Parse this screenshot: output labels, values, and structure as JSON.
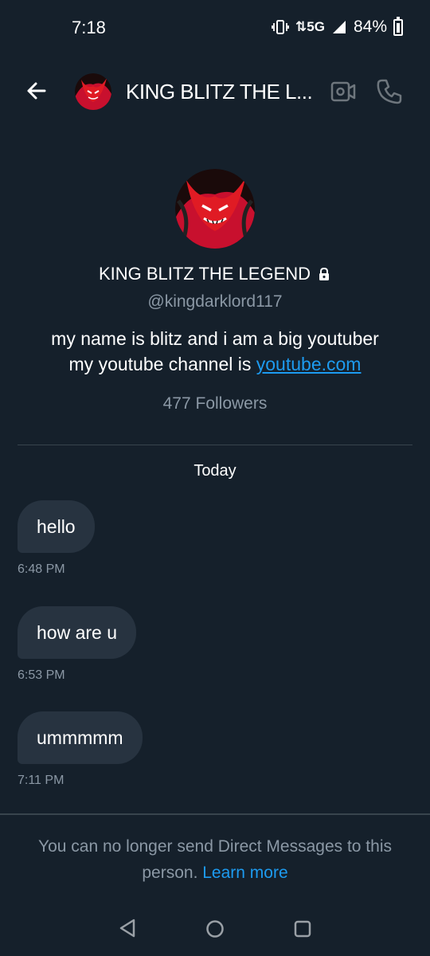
{
  "status_bar": {
    "time": "7:18",
    "network": "5G",
    "battery": "84%"
  },
  "header": {
    "title": "KING BLITZ THE L...",
    "back_icon": "back-arrow-icon",
    "video_icon": "video-call-icon",
    "call_icon": "phone-icon"
  },
  "profile": {
    "name": "KING BLITZ THE LEGEND",
    "handle": "@kingdarklord117",
    "bio_line1": "my name is blitz and i am a big youtuber",
    "bio_line2_prefix": "my youtube channel is ",
    "bio_link": "youtube.com",
    "followers": "477 Followers"
  },
  "conversation": {
    "date_label": "Today",
    "messages": [
      {
        "text": "hello",
        "time": "6:48 PM"
      },
      {
        "text": "how are u",
        "time": "6:53 PM"
      },
      {
        "text": "ummmmm",
        "time": "7:11 PM"
      }
    ]
  },
  "notice": {
    "text": "You can no longer send Direct Messages to this person.",
    "link": "Learn more"
  },
  "colors": {
    "background": "#15202b",
    "bubble": "#273340",
    "accent": "#1d9bf0",
    "muted_text": "#8b98a5"
  }
}
